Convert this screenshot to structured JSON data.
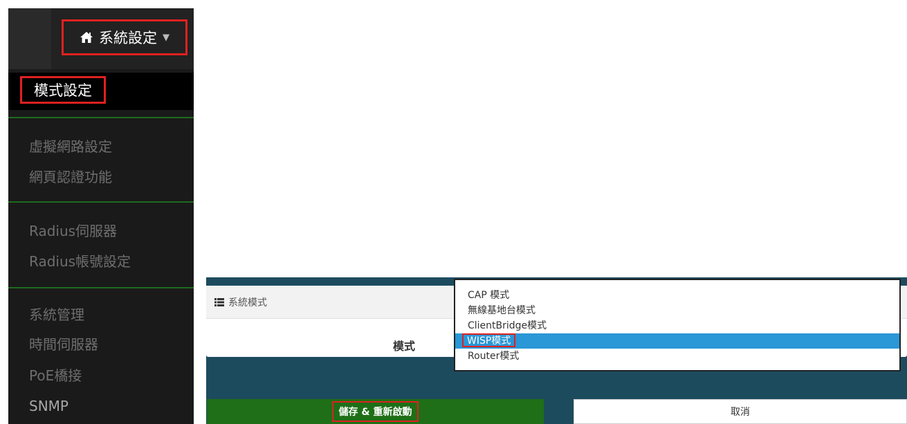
{
  "sidebar": {
    "menu_title": "系統設定",
    "active_item": "模式設定",
    "groups": [
      {
        "items": [
          "虛擬網路設定",
          "網頁認證功能"
        ]
      },
      {
        "items": [
          "Radius伺服器",
          "Radius帳號設定"
        ]
      },
      {
        "items": [
          "系統管理",
          "時間伺服器",
          "PoE橋接",
          "SNMP"
        ]
      }
    ]
  },
  "panel": {
    "title": "系統模式",
    "mode_label": "模式",
    "options": [
      "CAP 模式",
      "無線基地台模式",
      "ClientBridge模式",
      "WISP模式",
      "Router模式"
    ],
    "selected_option": "WISP模式"
  },
  "buttons": {
    "save": "儲存 & 重新啟動",
    "cancel": "取消"
  },
  "colors": {
    "highlight_box": "#e02020",
    "selected_option_bg": "#2a97d6",
    "save_button_bg": "#1e6f17",
    "panel_bg": "#1d4b5e",
    "sidebar_divider": "#1e6b1e"
  },
  "icons": {
    "menu_title": "home-icon",
    "menu_caret": "caret-down-icon",
    "panel_title": "list-icon"
  }
}
